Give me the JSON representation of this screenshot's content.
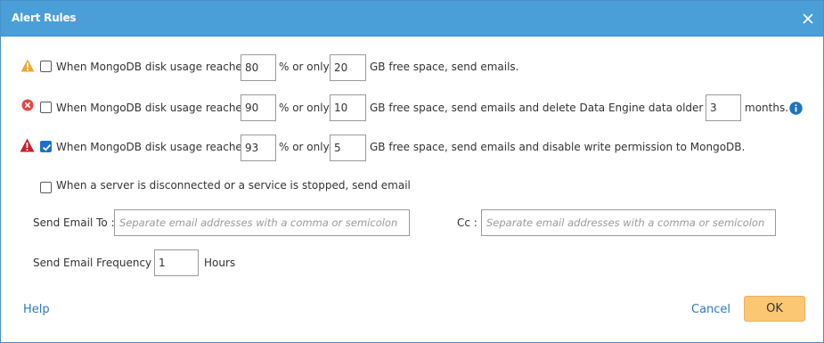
{
  "title": "Alert Rules",
  "rules": [
    {
      "checked": false,
      "icon": "warning-icon",
      "label_prefix": "When MongoDB disk usage reaches",
      "percent_value": "80",
      "label_mid": "% or only",
      "gb_value": "20",
      "label_suffix": "GB free space, send emails."
    },
    {
      "checked": false,
      "icon": "error-circle-icon",
      "label_prefix": "When MongoDB disk usage reaches",
      "percent_value": "90",
      "label_mid": "% or only",
      "gb_value": "10",
      "label_suffix": "GB free space, send emails and delete Data Engine data older than",
      "months_value": "3",
      "months_label": "months."
    },
    {
      "checked": true,
      "icon": "critical-triangle-icon",
      "label_prefix": "When MongoDB disk usage reaches",
      "percent_value": "93",
      "label_mid": "% or only",
      "gb_value": "5",
      "label_suffix": "GB free space, send emails and disable write permission to MongoDB."
    }
  ],
  "server_rule": {
    "checked": false,
    "label": "When a server is disconnected or a service is stopped, send email"
  },
  "send_to": {
    "label": "Send Email To :",
    "placeholder": "Separate email addresses with a comma or semicolon",
    "value": ""
  },
  "cc": {
    "label": "Cc :",
    "placeholder": "Separate email addresses with a comma or semicolon",
    "value": ""
  },
  "frequency": {
    "label": "Send Email Frequency :",
    "value": "1",
    "unit": "Hours"
  },
  "footer": {
    "help": "Help",
    "cancel": "Cancel",
    "ok": "OK"
  },
  "colors": {
    "titlebar": "#4a9fd8",
    "warning": "#f0a830",
    "error": "#e04848",
    "critical": "#c8202a",
    "info": "#1e73be",
    "link": "#2a78c8",
    "ok_button": "#fcc773",
    "checkbox_checked": "#1d6fc9"
  }
}
